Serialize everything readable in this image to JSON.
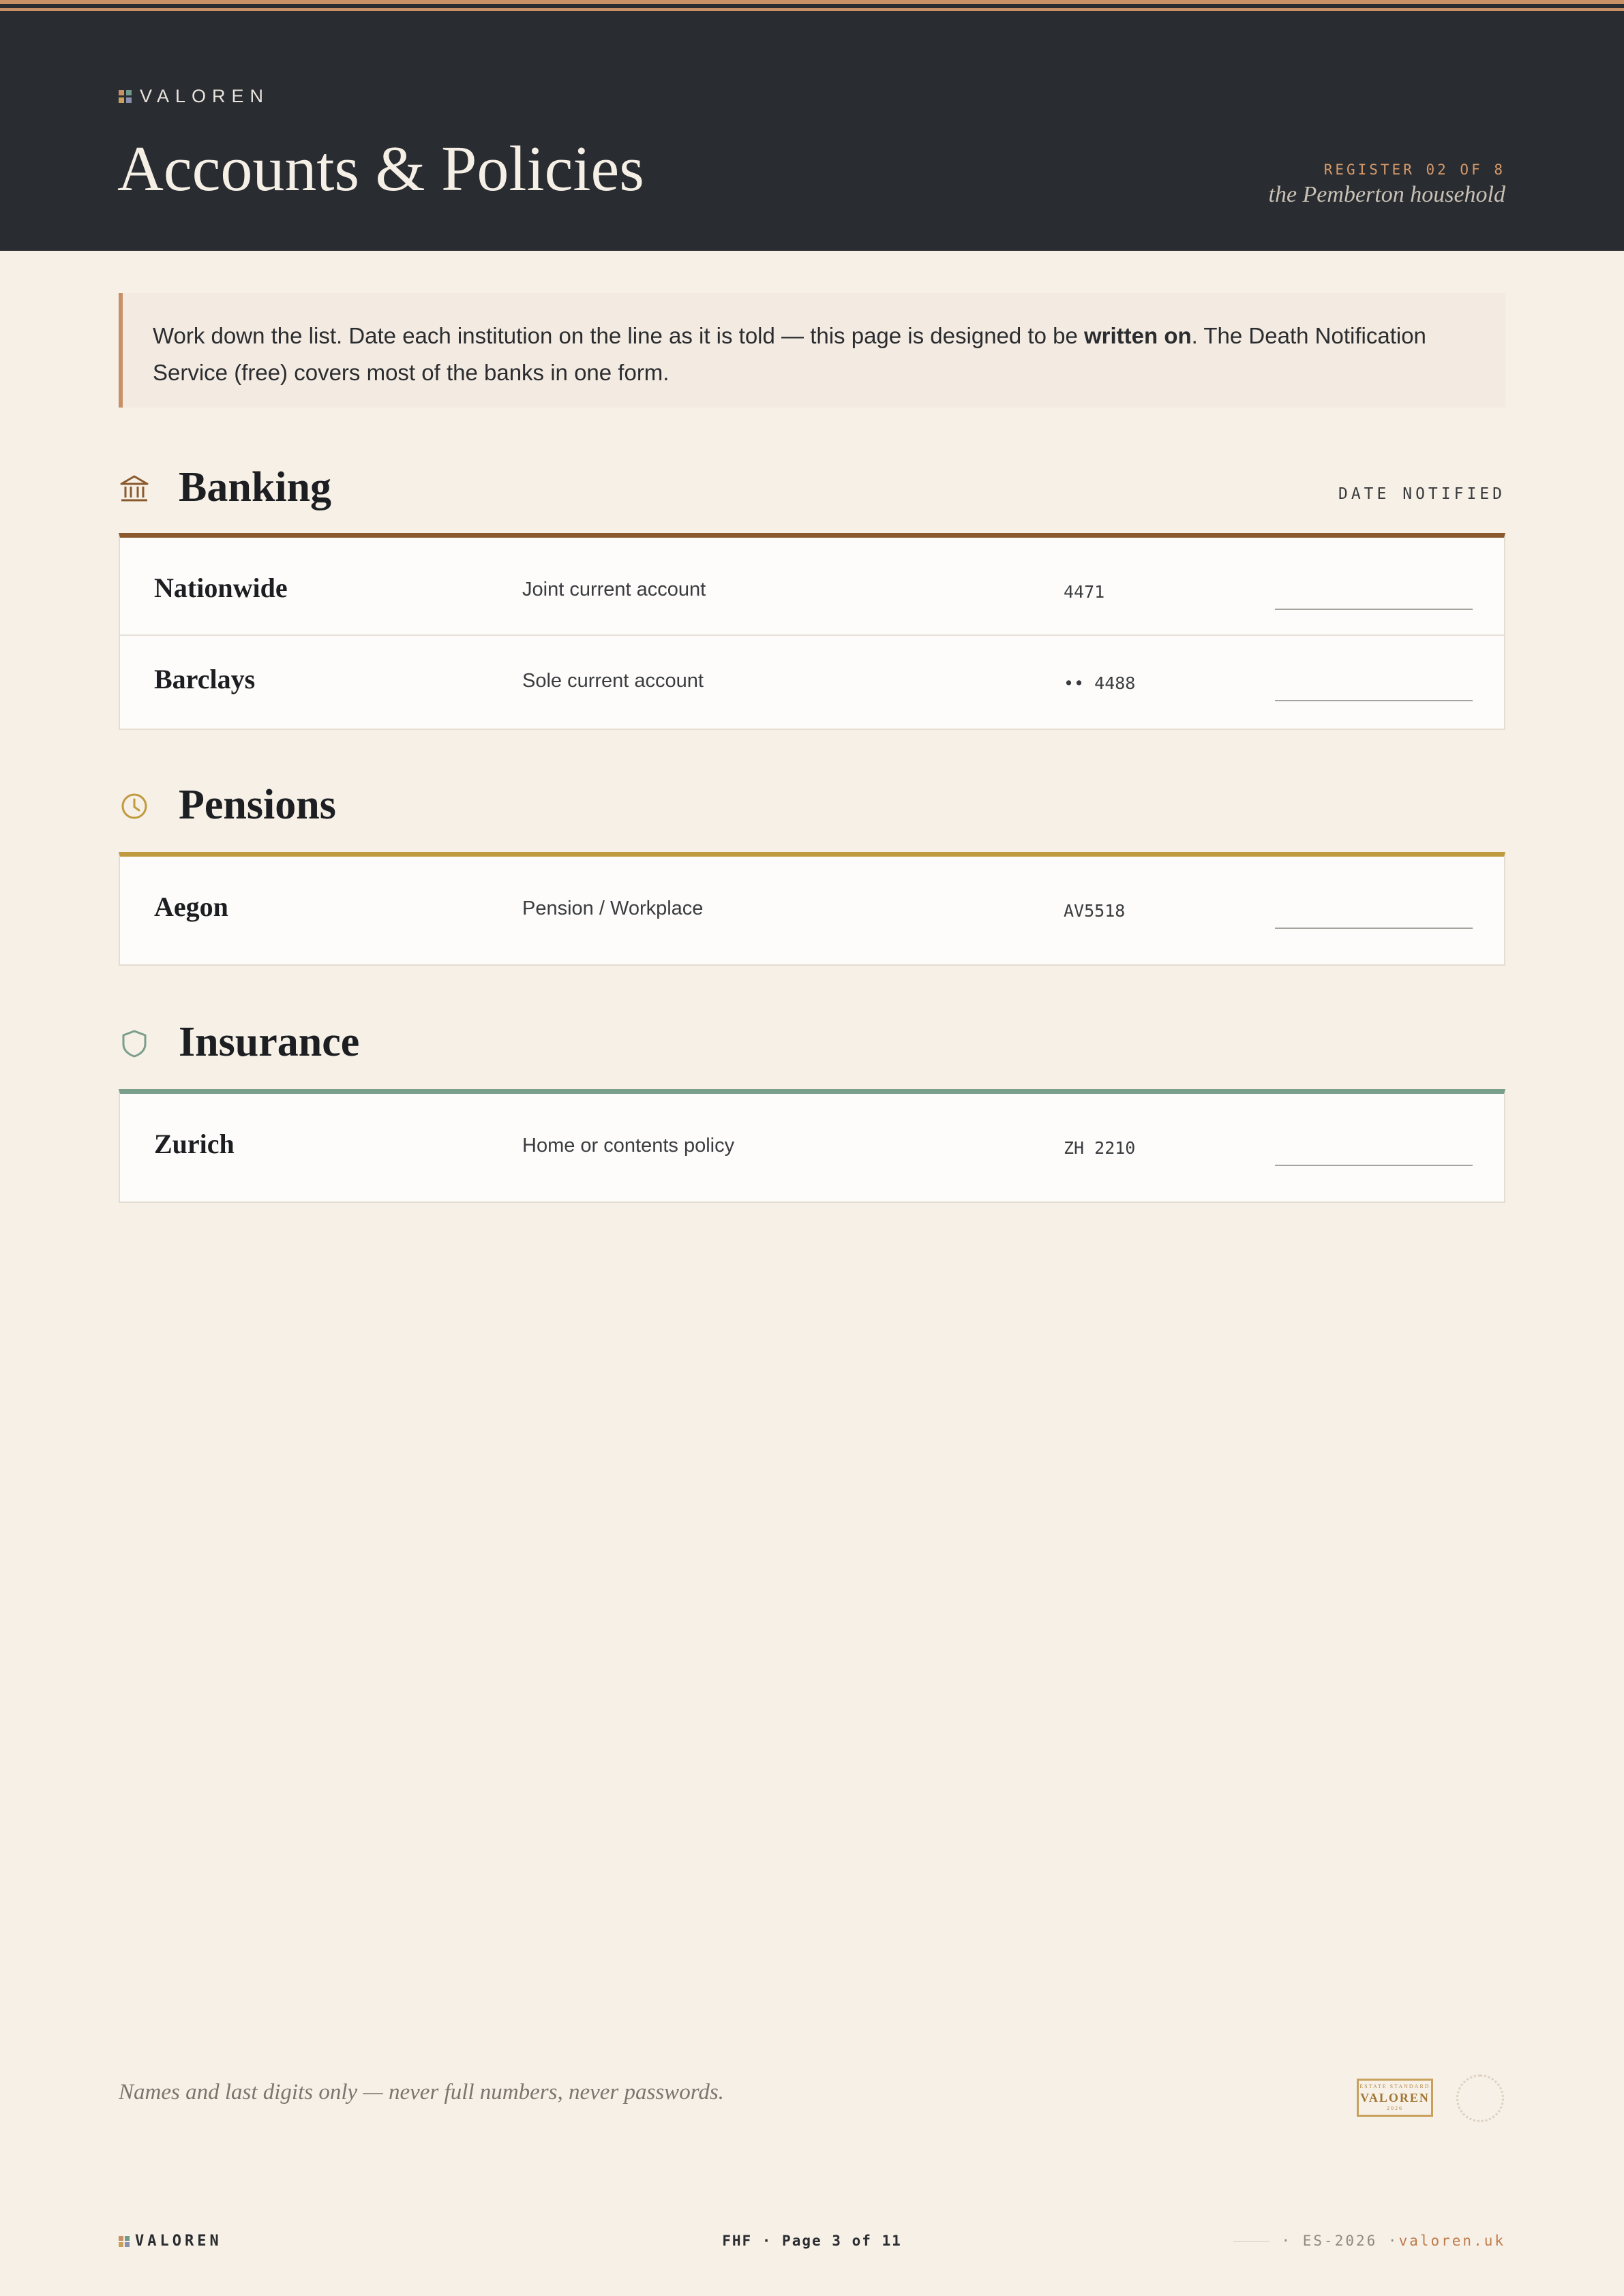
{
  "brand": {
    "name": "VALOREN",
    "colors": [
      "#c89066",
      "#6f9a8a",
      "#c9a15c",
      "#8a8fb0"
    ]
  },
  "header": {
    "title": "Accounts & Policies",
    "register_code": "REGISTER 02 OF 8",
    "household": "the Pemberton household"
  },
  "note": {
    "text_before": "Work down the list. Date each institution on the line as it is told — this page is designed to be ",
    "emphasis": "written on",
    "text_after": ". The Death Notification Service (free) covers most of the banks in one form."
  },
  "sections": {
    "banking": {
      "title": "Banking",
      "column_label": "DATE NOTIFIED",
      "accent": "#8a5a2e",
      "icon": "bank-icon",
      "rows": [
        {
          "institution": "Nationwide",
          "description": "Joint current account",
          "reference": "4471"
        },
        {
          "institution": "Barclays",
          "description": "Sole current account",
          "reference": "•• 4488"
        }
      ]
    },
    "pensions": {
      "title": "Pensions",
      "accent": "#c09a3e",
      "icon": "clock-icon",
      "rows": [
        {
          "institution": "Aegon",
          "description": "Pension / Workplace",
          "reference": "AV5518"
        }
      ]
    },
    "insurance": {
      "title": "Insurance",
      "accent": "#7a9e8c",
      "icon": "shield-icon",
      "rows": [
        {
          "institution": "Zurich",
          "description": "Home or contents policy",
          "reference": "ZH 2210"
        }
      ]
    }
  },
  "footer": {
    "disclaimer": "Names and last digits only — never full numbers, never passwords.",
    "seal_top": "ESTATE STANDARD",
    "seal_name": "VALOREN",
    "seal_bottom": "2026",
    "page": "FHF · Page 3 of 11",
    "code": "· ES-2026 ·",
    "site": "valoren.uk"
  }
}
